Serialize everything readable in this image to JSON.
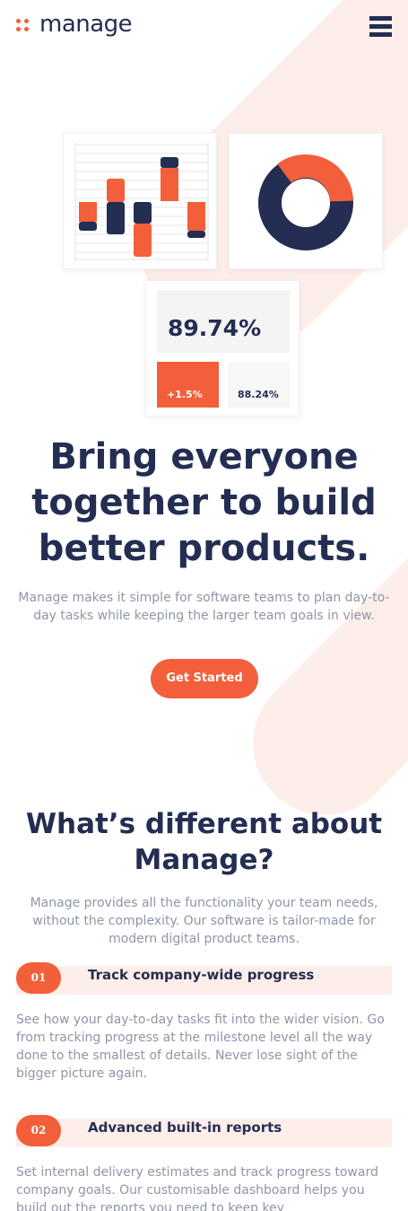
{
  "brand": {
    "name": "manage",
    "accent": "#f25f3a",
    "navy": "#242d52"
  },
  "nav": {
    "menu_icon": "hamburger-menu-icon"
  },
  "illustration": {
    "stat_main": "89.74%",
    "stat_change": "+1.5%",
    "stat_secondary": "88.24%"
  },
  "hero": {
    "title": "Bring everyone together to build better products.",
    "text": "Manage makes it simple for software teams to plan day-to-day tasks while keeping the larger team goals in view.",
    "cta": "Get Started"
  },
  "features_section": {
    "title": "What’s different about Manage?",
    "text": "Manage provides all the functionality your team needs, without the complexity. Our software is tailor-made for modern digital product teams.",
    "items": [
      {
        "number": "01",
        "title": "Track company-wide progress",
        "text": "See how your day-to-day tasks fit into the wider vision. Go from tracking progress at the milestone level all the way done to the smallest of details. Never lose sight of the bigger picture again."
      },
      {
        "number": "02",
        "title": "Advanced built-in reports",
        "text": "Set internal delivery estimates and track progress toward company goals. Our customisable dashboard helps you build out the reports you need to keep key"
      }
    ]
  }
}
